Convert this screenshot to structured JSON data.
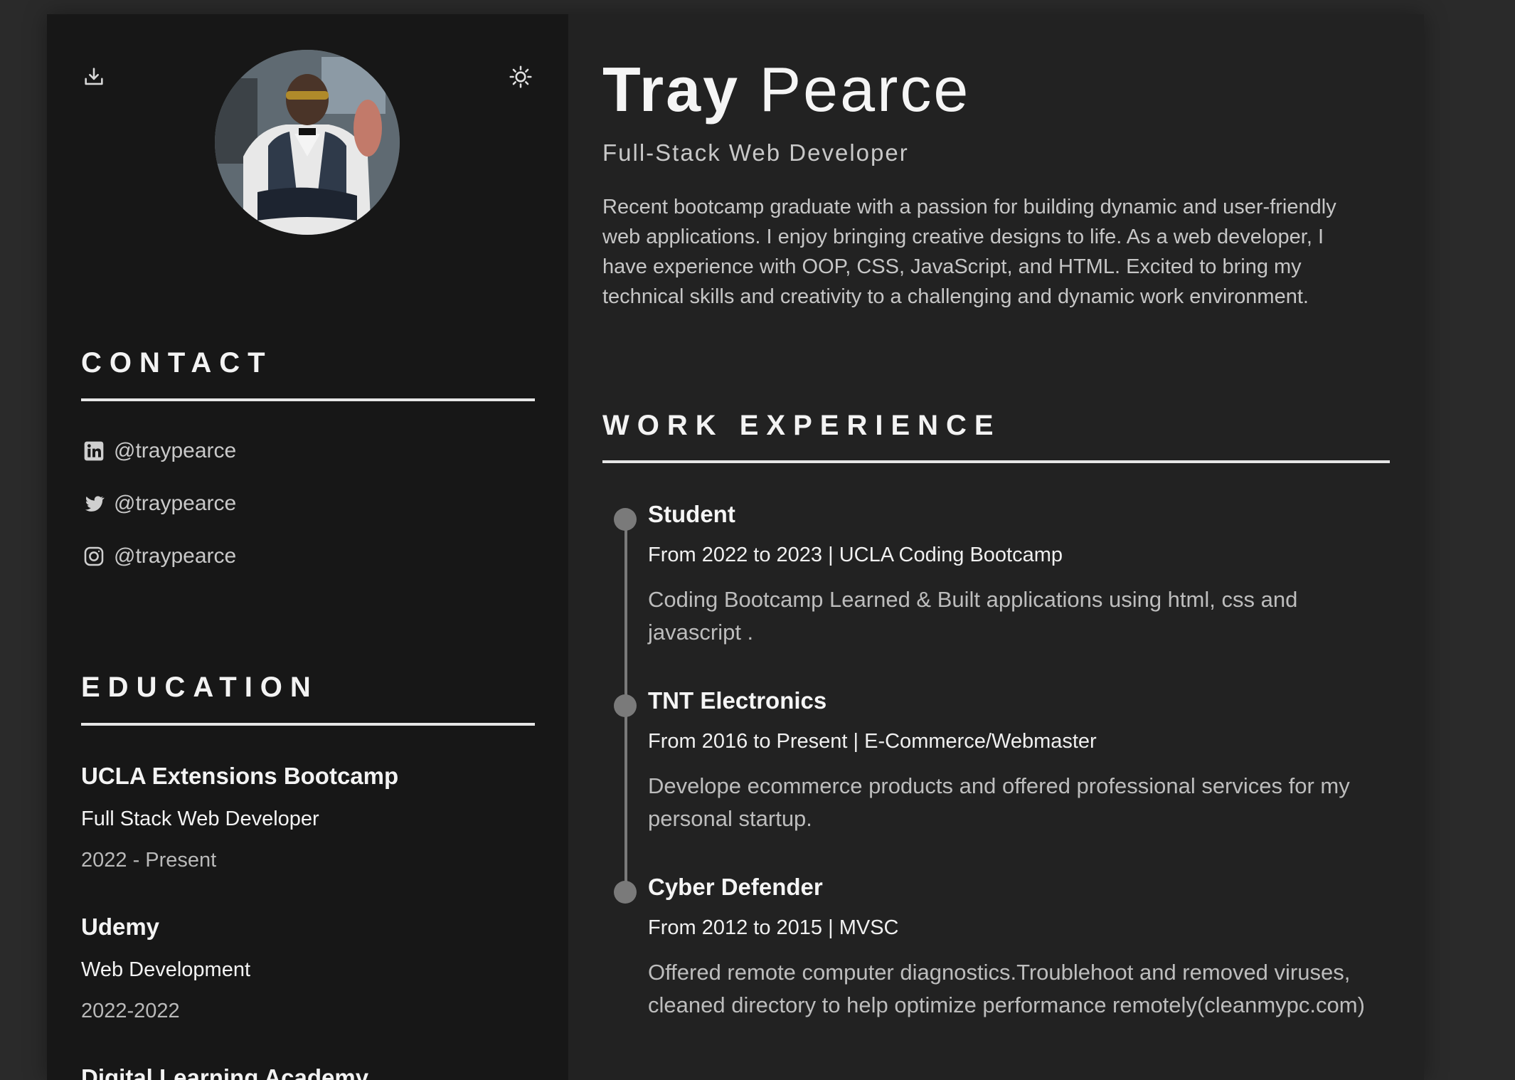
{
  "profile": {
    "first_name": "Tray",
    "last_name": "Pearce",
    "role": "Full-Stack Web Developer",
    "summary": "Recent bootcamp graduate with a passion for building dynamic and user-friendly web applications. I enjoy bringing creative designs to life. As a web developer, I have experience with OOP, CSS, JavaScript, and HTML. Excited to bring my technical skills and creativity to a challenging and dynamic work environment."
  },
  "toolbar": {
    "download_icon": "download-icon",
    "theme_icon": "sun-icon"
  },
  "contact": {
    "title": "CONTACT",
    "items": [
      {
        "icon": "linkedin-icon",
        "handle": "@traypearce"
      },
      {
        "icon": "twitter-icon",
        "handle": "@traypearce"
      },
      {
        "icon": "instagram-icon",
        "handle": "@traypearce"
      }
    ]
  },
  "education": {
    "title": "EDUCATION",
    "items": [
      {
        "school": "UCLA Extensions Bootcamp",
        "degree": "Full Stack Web Developer",
        "years": "2022 - Present"
      },
      {
        "school": "Udemy",
        "degree": "Web Development",
        "years": "2022-2022"
      },
      {
        "school": "Digital Learning Academy"
      }
    ]
  },
  "work": {
    "title": "WORK EXPERIENCE",
    "items": [
      {
        "title": "Student",
        "meta": "From 2022 to 2023 | UCLA Coding Bootcamp",
        "description": "Coding Bootcamp Learned & Built applications using html, css and javascript ."
      },
      {
        "title": "TNT Electronics",
        "meta": "From 2016 to Present | E-Commerce/Webmaster",
        "description": "Develope ecommerce products and offered professional services for my personal startup."
      },
      {
        "title": "Cyber Defender",
        "meta": "From 2012 to 2015 | MVSC",
        "description": "Offered remote computer diagnostics.Troublehoot and removed viruses, cleaned directory to help optimize performance remotely(cleanmypc.com)"
      }
    ]
  },
  "colors": {
    "background": "#2a2a2a",
    "sidebar": "#171717",
    "main": "#222222",
    "text": "#f3f3f3",
    "muted": "#bdbdbd",
    "timeline": "#7a7a7a"
  }
}
